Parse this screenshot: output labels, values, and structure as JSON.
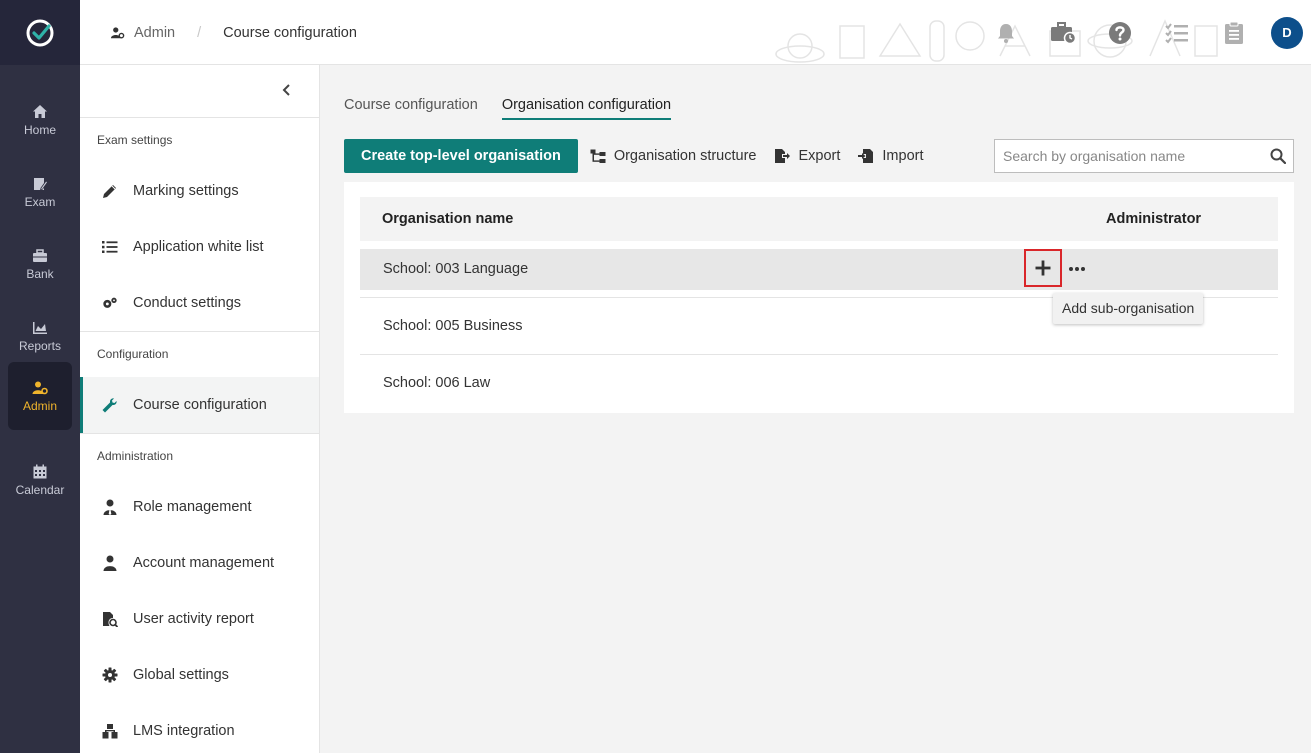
{
  "rail": {
    "items": [
      {
        "label": "Home",
        "icon": "home-icon"
      },
      {
        "label": "Exam",
        "icon": "exam-icon"
      },
      {
        "label": "Bank",
        "icon": "bank-icon"
      },
      {
        "label": "Reports",
        "icon": "reports-icon"
      },
      {
        "label": "Admin",
        "icon": "admin-icon",
        "active": true
      },
      {
        "label": "Calendar",
        "icon": "calendar-icon"
      }
    ]
  },
  "breadcrumb": {
    "parent": "Admin",
    "separator": "/",
    "current": "Course configuration"
  },
  "header": {
    "avatar_initial": "D"
  },
  "sidebar": {
    "sections": [
      {
        "title": "Exam settings",
        "items": [
          "Marking settings",
          "Application white list",
          "Conduct settings"
        ]
      },
      {
        "title": "Configuration",
        "items": [
          "Course configuration"
        ]
      },
      {
        "title": "Administration",
        "items": [
          "Role management",
          "Account management",
          "User activity report",
          "Global settings",
          "LMS integration"
        ]
      }
    ]
  },
  "tabs": [
    "Course configuration",
    "Organisation configuration"
  ],
  "toolbar": {
    "create_label": "Create top-level organisation",
    "structure_label": "Organisation structure",
    "export_label": "Export",
    "import_label": "Import"
  },
  "search": {
    "placeholder": "Search by organisation name",
    "value": ""
  },
  "table": {
    "headers": {
      "name": "Organisation name",
      "admin": "Administrator"
    },
    "rows": [
      {
        "name": "School: 003 Language"
      },
      {
        "name": "School: 005 Business"
      },
      {
        "name": "School: 006 Law"
      }
    ]
  },
  "tooltip": {
    "text": "Add sub-organisation"
  },
  "colors": {
    "accent": "#0f7d78",
    "rail_bg": "#2f3042",
    "active_rail": "#f0b42c",
    "avatar": "#0d4f8b",
    "highlight": "#d9262a"
  }
}
